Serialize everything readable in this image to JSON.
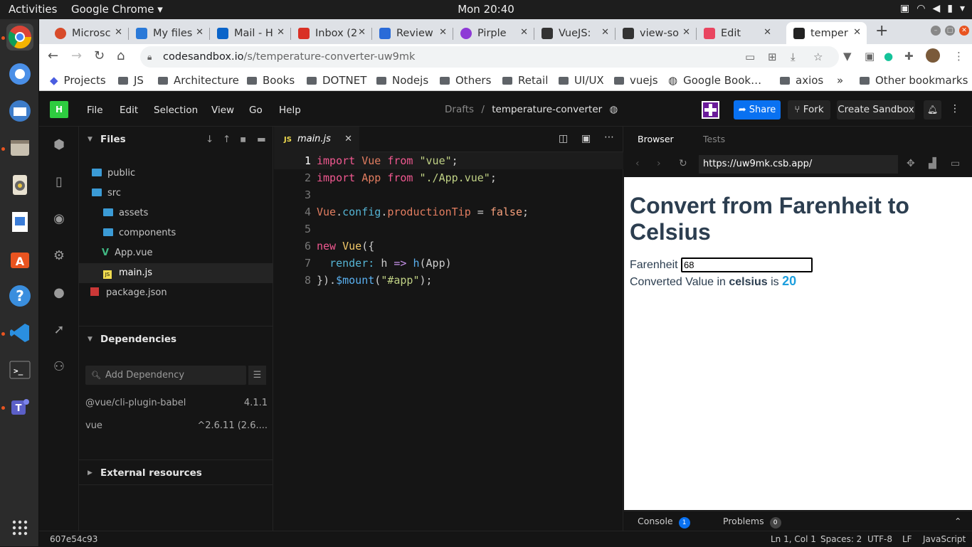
{
  "topbar": {
    "activities": "Activities",
    "app": "Google Chrome ▾",
    "clock": "Mon 20:40"
  },
  "tabs": [
    {
      "label": "Microsc",
      "color": "#d84b2a"
    },
    {
      "label": "My files",
      "color": "#2a79d8"
    },
    {
      "label": "Mail - H",
      "color": "#0a64c9"
    },
    {
      "label": "Inbox (2",
      "color": "#d93025"
    },
    {
      "label": "Review",
      "color": "#2a6bd8"
    },
    {
      "label": "Pirple",
      "color": "#8e3ad6"
    },
    {
      "label": "VueJS:",
      "color": "#333333"
    },
    {
      "label": "view-so",
      "color": "#333333"
    },
    {
      "label": "Edit",
      "color": "#e94560"
    },
    {
      "label": "temper",
      "color": "#222222"
    }
  ],
  "url": {
    "host": "codesandbox.io",
    "path": "/s/temperature-converter-uw9mk"
  },
  "bookmarks": [
    "Projects",
    "JS",
    "Architecture",
    "Books",
    "DOTNET",
    "Nodejs",
    "Others",
    "Retail",
    "UI/UX",
    "vuejs",
    "Google Book…",
    "axios",
    "»",
    "Other bookmarks"
  ],
  "menu": [
    "File",
    "Edit",
    "Selection",
    "View",
    "Go",
    "Help"
  ],
  "breadcrumb": {
    "parent": "Drafts",
    "sep": "/",
    "name": "temperature-converter"
  },
  "actions": {
    "share": "Share",
    "fork": "Fork",
    "create": "Create Sandbox"
  },
  "files": {
    "title": "Files",
    "items": [
      {
        "name": "public",
        "type": "folder"
      },
      {
        "name": "src",
        "type": "folder"
      },
      {
        "name": "assets",
        "type": "folder"
      },
      {
        "name": "components",
        "type": "folder"
      },
      {
        "name": "App.vue",
        "type": "vue"
      },
      {
        "name": "main.js",
        "type": "js"
      },
      {
        "name": "package.json",
        "type": "json"
      }
    ]
  },
  "dependencies": {
    "title": "Dependencies",
    "placeholder": "Add Dependency",
    "items": [
      {
        "name": "@vue/cli-plugin-babel",
        "version": "4.1.1"
      },
      {
        "name": "vue",
        "version": "^2.6.11 (2.6...."
      }
    ]
  },
  "external": "External resources",
  "editor": {
    "tab": "main.js",
    "lines": [
      "1",
      "2",
      "3",
      "4",
      "5",
      "6",
      "7",
      "8"
    ]
  },
  "preview": {
    "tab_browser": "Browser",
    "tab_tests": "Tests",
    "url": "https://uw9mk.csb.app/",
    "heading": "Convert from Farenheit to Celsius",
    "label": "Farenheit",
    "input_value": "68",
    "result_prefix": "Converted Value in",
    "result_unit": "celsius",
    "result_is": "is",
    "result_value": "20",
    "console": "Console",
    "console_count": "1",
    "problems": "Problems",
    "problems_count": "0"
  },
  "status": {
    "hash": "607e54c93",
    "pos": "Ln 1, Col 1",
    "spaces": "Spaces: 2",
    "enc": "UTF-8",
    "eol": "LF",
    "lang": "JavaScript"
  }
}
